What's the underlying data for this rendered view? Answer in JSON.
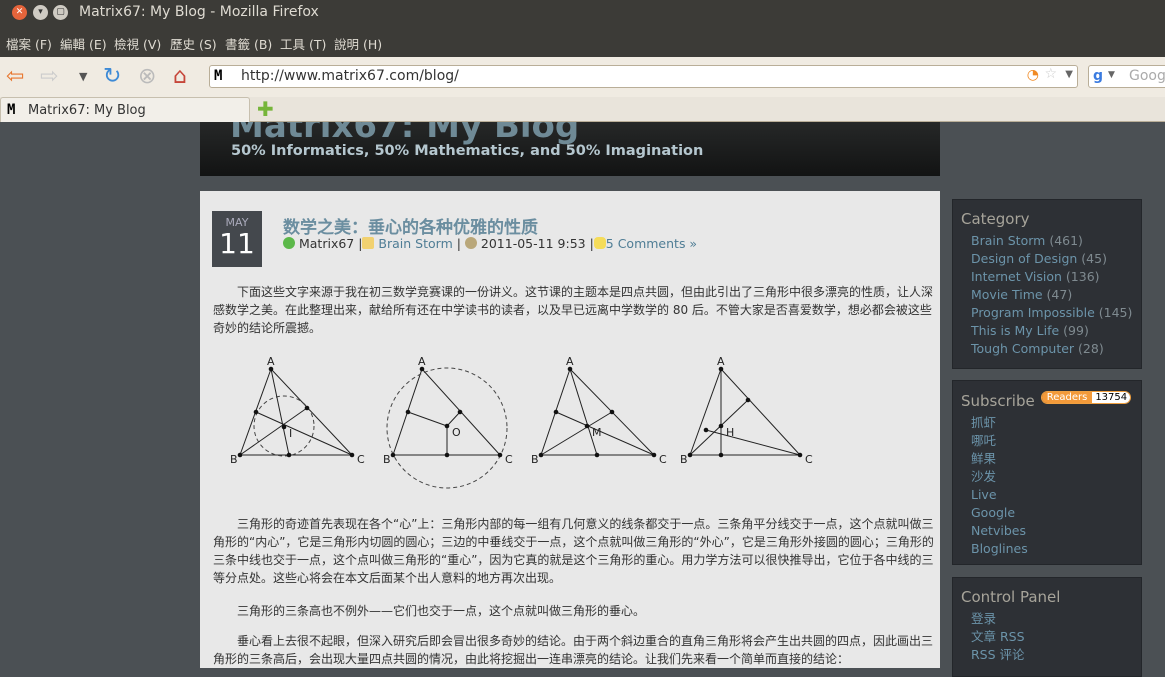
{
  "window": {
    "title": "Matrix67: My Blog - Mozilla Firefox"
  },
  "menu": [
    "檔案 (F)",
    "編輯 (E)",
    "檢視 (V)",
    "歷史 (S)",
    "書籤 (B)",
    "工具 (T)",
    "說明 (H)"
  ],
  "nav": {
    "url": "http://www.matrix67.com/blog/",
    "search_placeholder": "Goog"
  },
  "tabs": [
    {
      "label": "Matrix67: My Blog"
    }
  ],
  "banner": {
    "title": "Matrix67: My Blog",
    "subtitle": "50% Informatics, 50% Mathematics, and 50% Imagination"
  },
  "post": {
    "month": "MAY",
    "day": "11",
    "title": "数学之美：垂心的各种优雅的性质",
    "author": "Matrix67",
    "category": "Brain Storm",
    "datetime": "2011-05-11 9:53",
    "comments": "5 Comments »",
    "paragraphs": [
      "下面这些文字来源于我在初三数学竞赛课的一份讲义。这节课的主题本是四点共圆，但由此引出了三角形中很多漂亮的性质，让人深感数学之美。在此整理出来，献给所有还在中学读书的读者，以及早已远离中学数学的 80 后。不管大家是否喜爱数学，想必都会被这些奇妙的结论所震撼。",
      "三角形的奇迹首先表现在各个“心”上：三角形内部的每一组有几何意义的线条都交于一点。三条角平分线交于一点，这个点就叫做三角形的“内心”，它是三角形内切圆的圆心；三边的中垂线交于一点，这个点就叫做三角形的“外心”，它是三角形外接圆的圆心；三角形的三条中线也交于一点，这个点叫做三角形的“重心”，因为它真的就是这个三角形的重心。用力学方法可以很快推导出，它位于各中线的三等分点处。这些心将会在本文后面某个出人意料的地方再次出现。",
      "三角形的三条高也不例外——它们也交于一点，这个点就叫做三角形的垂心。",
      "垂心看上去很不起眼，但深入研究后即会冒出很多奇妙的结论。由于两个斜边重合的直角三角形将会产生出共圆的四点，因此画出三角形的三条高后，会出现大量四点共圆的情况，由此将挖掘出一连串漂亮的结论。让我们先来看一个简单而直接的结论："
    ],
    "figure_labels": {
      "A": "A",
      "B": "B",
      "C": "C",
      "centers": [
        "I",
        "O",
        "M",
        "H"
      ]
    }
  },
  "sidebar": {
    "category": {
      "title": "Category",
      "items": [
        {
          "name": "Brain Storm",
          "count": "(461)"
        },
        {
          "name": "Design of Design",
          "count": "(45)"
        },
        {
          "name": "Internet Vision",
          "count": "(136)"
        },
        {
          "name": "Movie Time",
          "count": "(47)"
        },
        {
          "name": "Program Impossible",
          "count": "(145)"
        },
        {
          "name": "This is My Life",
          "count": "(99)"
        },
        {
          "name": "Tough Computer",
          "count": "(28)"
        }
      ]
    },
    "subscribe": {
      "title": "Subscribe",
      "readers_label": "Readers",
      "readers_count": "13754",
      "items": [
        "抓虾",
        "哪吒",
        "鲜果",
        "沙发",
        "Live",
        "Google",
        "Netvibes",
        "Bloglines"
      ]
    },
    "control": {
      "title": "Control Panel",
      "items": [
        "登录",
        "文章 RSS",
        "RSS 评论"
      ]
    }
  }
}
